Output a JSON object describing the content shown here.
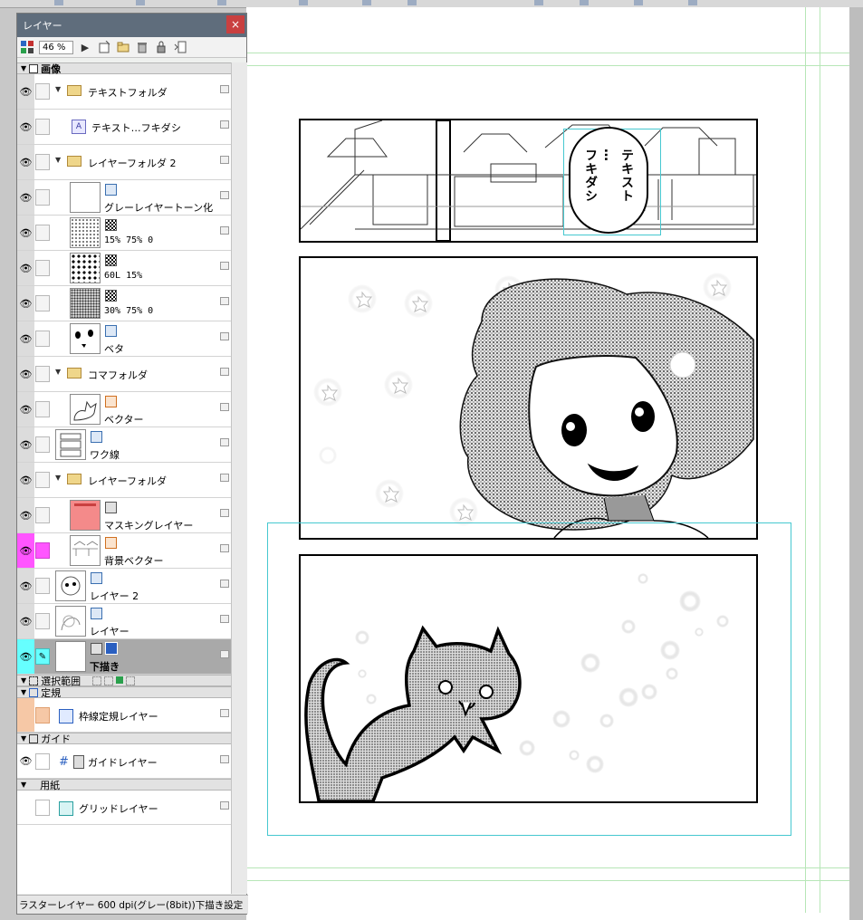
{
  "panel": {
    "title": "レイヤー",
    "close": "×",
    "zoom": "46 %",
    "status": "ラスターレイヤー 600 dpi(グレー(8bit))下描き設定"
  },
  "categories": {
    "image": "画像",
    "selection": "選択範囲",
    "ruler": "定規",
    "guide": "ガイド",
    "paper": "用紙"
  },
  "layers": [
    {
      "name": "テキストフォルダ",
      "kind": "folder"
    },
    {
      "name": "テキスト…フキダシ",
      "kind": "text"
    },
    {
      "name": "レイヤーフォルダ 2",
      "kind": "folder"
    },
    {
      "name": "グレーレイヤートーン化",
      "kind": "raster"
    },
    {
      "name": "15% 75% 0",
      "kind": "tone"
    },
    {
      "name": "60L 15%",
      "kind": "tone"
    },
    {
      "name": "30% 75% 0",
      "kind": "tone"
    },
    {
      "name": "ベタ",
      "kind": "raster"
    },
    {
      "name": "コマフォルダ",
      "kind": "folder"
    },
    {
      "name": "ベクター",
      "kind": "vector"
    },
    {
      "name": "ワク線",
      "kind": "raster"
    },
    {
      "name": "レイヤーフォルダ",
      "kind": "folder"
    },
    {
      "name": "マスキングレイヤー",
      "kind": "mask"
    },
    {
      "name": "背景ベクター",
      "kind": "vector"
    },
    {
      "name": "レイヤー 2",
      "kind": "raster"
    },
    {
      "name": "レイヤー",
      "kind": "raster"
    },
    {
      "name": "下描き",
      "kind": "raster"
    }
  ],
  "ruler_layer": "枠線定規レイヤー",
  "guide_layer": "ガイドレイヤー",
  "grid_layer": "グリッドレイヤー",
  "balloon_text": [
    "テキスト",
    "…",
    "フキダシ"
  ],
  "colors": {
    "title_bar": "#5f6d7c",
    "selected_row": "#a9a9a9",
    "magenta_highlight": "#ff55ff",
    "cyan_highlight": "#66ffff",
    "ruler_highlight": "#f6c8a6",
    "selection_frame": "#46c8d0",
    "guide_line": "#b7e6b7"
  }
}
